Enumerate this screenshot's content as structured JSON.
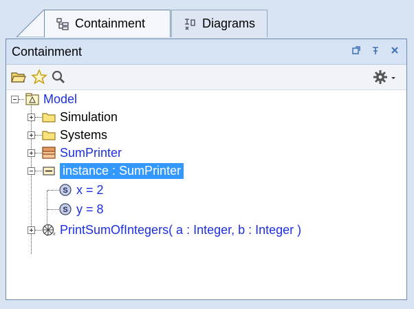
{
  "tabs": [
    {
      "label": "Containment",
      "icon": "containment-tree-icon",
      "active": true
    },
    {
      "label": "Diagrams",
      "icon": "diagrams-icon",
      "active": false
    }
  ],
  "panel": {
    "title": "Containment",
    "controls": [
      "restore-icon",
      "pin-icon",
      "close-icon"
    ],
    "toolbar": [
      "open-folder-icon",
      "star-icon",
      "search-icon",
      "gear-icon",
      "dropdown-arrow-icon"
    ]
  },
  "tree": [
    {
      "label": "Model",
      "icon": "model-package-icon",
      "blue": true,
      "selected": false,
      "expander": "minus"
    },
    {
      "label": "Simulation",
      "icon": "folder-icon",
      "blue": false,
      "selected": false,
      "expander": "plus"
    },
    {
      "label": "Systems",
      "icon": "folder-icon",
      "blue": false,
      "selected": false,
      "expander": "plus"
    },
    {
      "label": "SumPrinter",
      "icon": "block-class-icon",
      "blue": true,
      "selected": false,
      "expander": "plus"
    },
    {
      "label": "instance : SumPrinter",
      "icon": "instance-spec-icon",
      "blue": false,
      "selected": true,
      "expander": "minus"
    },
    {
      "label": "x = 2",
      "icon": "slot-icon",
      "blue": true,
      "selected": false,
      "expander": ""
    },
    {
      "label": "y = 8",
      "icon": "slot-icon",
      "blue": true,
      "selected": false,
      "expander": ""
    },
    {
      "label": "PrintSumOfIntegers( a : Integer, b : Integer )",
      "icon": "activity-icon",
      "blue": true,
      "selected": false,
      "expander": "plus"
    }
  ],
  "colors": {
    "accent": "#3399ff",
    "link": "#1c2ee0",
    "title_bg": "#d6e3f4"
  }
}
